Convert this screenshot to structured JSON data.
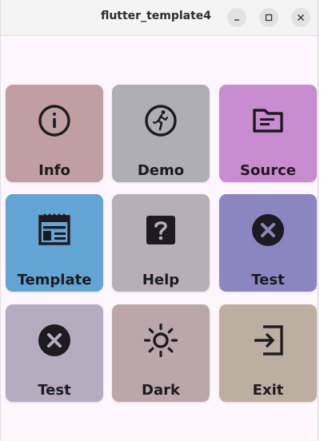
{
  "window": {
    "title": "flutter_template4",
    "minimize_icon": "minimize-icon",
    "maximize_icon": "maximize-icon",
    "close_icon": "close-icon"
  },
  "tiles": [
    {
      "label": "Info",
      "icon": "info-icon",
      "color": "#c09ea1"
    },
    {
      "label": "Demo",
      "icon": "run-icon",
      "color": "#afaeb5"
    },
    {
      "label": "Source",
      "icon": "folder-icon",
      "color": "#c98cd0"
    },
    {
      "label": "Template",
      "icon": "template-icon",
      "color": "#62a4d4"
    },
    {
      "label": "Help",
      "icon": "help-icon",
      "color": "#b7afb8"
    },
    {
      "label": "Test",
      "icon": "cancel-icon",
      "color": "#8c86c0"
    },
    {
      "label": "Test",
      "icon": "cancel-icon",
      "color": "#b6acc0"
    },
    {
      "label": "Dark",
      "icon": "light-mode-icon",
      "color": "#baa6ab"
    },
    {
      "label": "Exit",
      "icon": "exit-icon",
      "color": "#bcaea0"
    }
  ]
}
